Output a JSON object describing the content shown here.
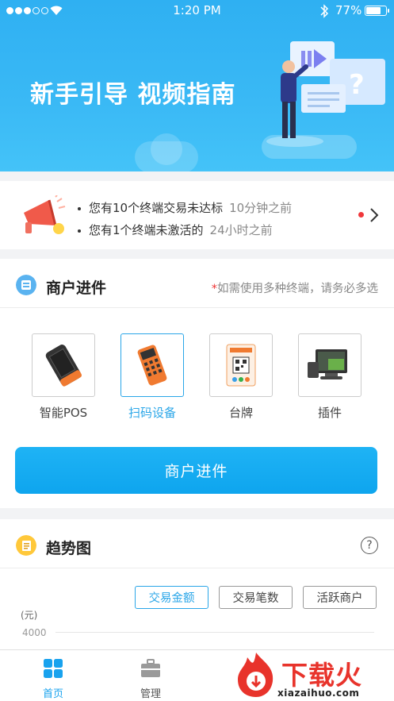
{
  "status_bar": {
    "signal_bars": 3,
    "time": "1:20 PM",
    "battery_percent": "77%",
    "battery_level": 0.77
  },
  "banner": {
    "title": "新手引导 视频指南"
  },
  "notice": {
    "items": [
      {
        "text": "您有10个终端交易未达标",
        "time": "10分钟之前"
      },
      {
        "text": "您有1个终端未激活的",
        "time": "24小时之前"
      }
    ]
  },
  "merchant": {
    "title": "商户进件",
    "hint_star": "*",
    "hint": "如需使用多种终端，请务必多选",
    "devices": [
      {
        "label": "智能POS",
        "selected": false
      },
      {
        "label": "扫码设备",
        "selected": true
      },
      {
        "label": "台牌",
        "selected": false
      },
      {
        "label": "插件",
        "selected": false
      }
    ],
    "button_label": "商户进件"
  },
  "trend": {
    "title": "趋势图",
    "help": "?",
    "filters": [
      {
        "label": "交易金额",
        "active": true
      },
      {
        "label": "交易笔数",
        "active": false
      },
      {
        "label": "活跃商户",
        "active": false
      }
    ],
    "chart_data": {
      "type": "line",
      "ylabel": "(元)",
      "y_ticks": [
        "4000"
      ]
    }
  },
  "tabbar": {
    "tabs": [
      {
        "label": "首页",
        "icon": "grid-icon",
        "active": true
      },
      {
        "label": "管理",
        "icon": "briefcase-icon",
        "active": false
      }
    ]
  },
  "watermark": {
    "text": "下载火",
    "sub": "xiazaihuo.com"
  },
  "colors": {
    "accent": "#18a2ee",
    "banner": "#3ab9f5",
    "alert": "#f0383b"
  }
}
